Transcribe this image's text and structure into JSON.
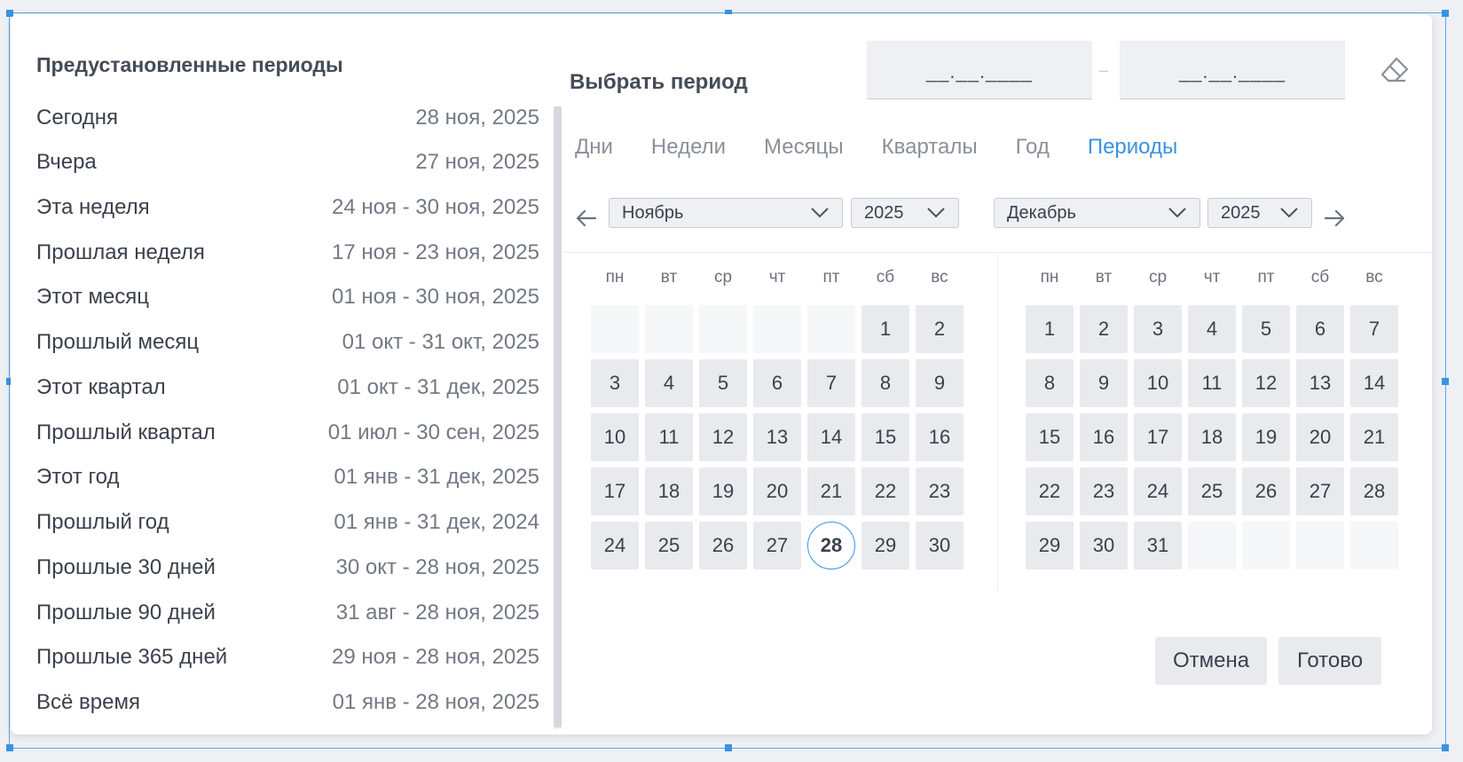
{
  "presets": {
    "title": "Предустановленные периоды",
    "items": [
      {
        "label": "Сегодня",
        "range": "28 ноя, 2025"
      },
      {
        "label": "Вчера",
        "range": "27 ноя, 2025"
      },
      {
        "label": "Эта неделя",
        "range": "24 ноя - 30 ноя, 2025"
      },
      {
        "label": "Прошлая неделя",
        "range": "17 ноя - 23 ноя, 2025"
      },
      {
        "label": "Этот месяц",
        "range": "01 ноя - 30 ноя, 2025"
      },
      {
        "label": "Прошлый месяц",
        "range": "01 окт - 31 окт, 2025"
      },
      {
        "label": "Этот квартал",
        "range": "01 окт - 31 дек, 2025"
      },
      {
        "label": "Прошлый квартал",
        "range": "01 июл - 30 сен, 2025"
      },
      {
        "label": "Этот год",
        "range": "01 янв - 31 дек, 2025"
      },
      {
        "label": "Прошлый год",
        "range": "01 янв - 31 дек, 2024"
      },
      {
        "label": "Прошлые 30 дней",
        "range": "30 окт - 28 ноя, 2025"
      },
      {
        "label": "Прошлые 90 дней",
        "range": "31 авг - 28 ноя, 2025"
      },
      {
        "label": "Прошлые 365 дней",
        "range": "29 ноя - 28 ноя, 2025"
      },
      {
        "label": "Всё время",
        "range": "01 янв - 28 ноя, 2025"
      }
    ]
  },
  "range_picker": {
    "title": "Выбрать период",
    "from_placeholder": "__.__.____",
    "to_placeholder": "__.__.____",
    "separator": "–",
    "clear_icon": "eraser-icon"
  },
  "tabs": [
    {
      "label": "Дни",
      "active": false
    },
    {
      "label": "Недели",
      "active": false
    },
    {
      "label": "Месяцы",
      "active": false
    },
    {
      "label": "Кварталы",
      "active": false
    },
    {
      "label": "Год",
      "active": false
    },
    {
      "label": "Периоды",
      "active": true
    }
  ],
  "calendars": {
    "left": {
      "month": "Ноябрь",
      "year": "2025",
      "leading_blanks": 5,
      "days_in_month": 30,
      "trailing_blanks": 0,
      "today": 28
    },
    "right": {
      "month": "Декабрь",
      "year": "2025",
      "leading_blanks": 0,
      "days_in_month": 31,
      "trailing_blanks": 4,
      "today": null
    },
    "weekdays": [
      "пн",
      "вт",
      "ср",
      "чт",
      "пт",
      "сб",
      "вс"
    ],
    "prev_icon": "arrow-left-icon",
    "next_icon": "arrow-right-icon"
  },
  "buttons": {
    "cancel": "Отмена",
    "done": "Готово"
  },
  "colors": {
    "accent": "#3a93e0",
    "day_bg": "#e9eaee",
    "input_bg": "#eef0f3"
  }
}
